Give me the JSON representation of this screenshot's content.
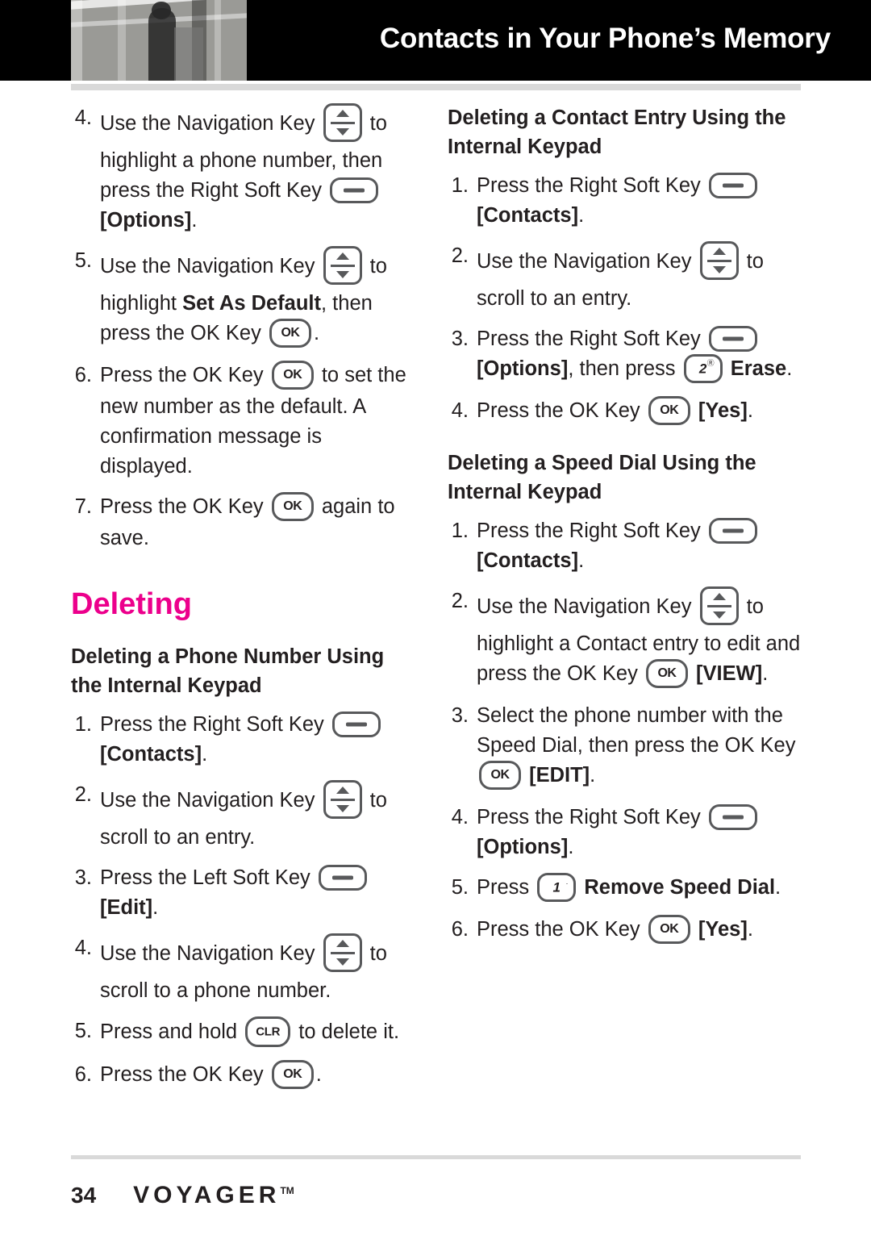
{
  "header": {
    "title": "Contacts in Your Phone’s Memory",
    "photo_alt": "header-photo"
  },
  "left_column": {
    "steps": [
      {
        "num": "4.",
        "parts": [
          {
            "t": "text",
            "v": "Use the Navigation Key "
          },
          {
            "t": "icon",
            "v": "navigation-key"
          },
          {
            "t": "text",
            "v": " to highlight a phone number, then press the Right Soft Key "
          },
          {
            "t": "icon",
            "v": "soft-key"
          },
          {
            "t": "text",
            "v": " "
          },
          {
            "t": "bold",
            "v": "[Options]"
          },
          {
            "t": "text",
            "v": "."
          }
        ]
      },
      {
        "num": "5.",
        "parts": [
          {
            "t": "text",
            "v": "Use the Navigation Key "
          },
          {
            "t": "icon",
            "v": "navigation-key"
          },
          {
            "t": "text",
            "v": " to highlight "
          },
          {
            "t": "bold",
            "v": "Set As Default"
          },
          {
            "t": "text",
            "v": ", then press the OK Key "
          },
          {
            "t": "icon",
            "v": "ok-key"
          },
          {
            "t": "text",
            "v": "."
          }
        ]
      },
      {
        "num": "6.",
        "parts": [
          {
            "t": "text",
            "v": "Press the OK Key "
          },
          {
            "t": "icon",
            "v": "ok-key"
          },
          {
            "t": "text",
            "v": " to set the new number as the default. A confirmation message is displayed."
          }
        ]
      },
      {
        "num": "7.",
        "parts": [
          {
            "t": "text",
            "v": "Press the OK Key "
          },
          {
            "t": "icon",
            "v": "ok-key"
          },
          {
            "t": "text",
            "v": " again to save."
          }
        ]
      }
    ],
    "section_title": "Deleting",
    "subhead": "Deleting a Phone Number Using the Internal Keypad",
    "steps2": [
      {
        "num": "1.",
        "parts": [
          {
            "t": "text",
            "v": "Press the Right Soft Key "
          },
          {
            "t": "icon",
            "v": "soft-key"
          },
          {
            "t": "text",
            "v": " "
          },
          {
            "t": "bold",
            "v": "[Contacts]"
          },
          {
            "t": "text",
            "v": "."
          }
        ]
      },
      {
        "num": "2.",
        "parts": [
          {
            "t": "text",
            "v": "Use the Navigation Key "
          },
          {
            "t": "icon",
            "v": "navigation-key"
          },
          {
            "t": "text",
            "v": " to scroll to an entry."
          }
        ]
      },
      {
        "num": "3.",
        "parts": [
          {
            "t": "text",
            "v": "Press the Left Soft Key "
          },
          {
            "t": "icon",
            "v": "soft-key"
          },
          {
            "t": "text",
            "v": " "
          },
          {
            "t": "bold",
            "v": "[Edit]"
          },
          {
            "t": "text",
            "v": "."
          }
        ]
      },
      {
        "num": "4.",
        "parts": [
          {
            "t": "text",
            "v": "Use the Navigation Key "
          },
          {
            "t": "icon",
            "v": "navigation-key"
          },
          {
            "t": "text",
            "v": " to scroll to a phone number."
          }
        ]
      },
      {
        "num": "5.",
        "parts": [
          {
            "t": "text",
            "v": "Press and hold "
          },
          {
            "t": "icon",
            "v": "clr-key"
          },
          {
            "t": "text",
            "v": " to delete it."
          }
        ]
      },
      {
        "num": "6.",
        "parts": [
          {
            "t": "text",
            "v": "Press the OK Key "
          },
          {
            "t": "icon",
            "v": "ok-key"
          },
          {
            "t": "text",
            "v": "."
          }
        ]
      }
    ]
  },
  "right_column": {
    "subhead1": "Deleting a Contact Entry Using the Internal Keypad",
    "steps1": [
      {
        "num": "1.",
        "parts": [
          {
            "t": "text",
            "v": "Press the Right Soft Key "
          },
          {
            "t": "icon",
            "v": "soft-key"
          },
          {
            "t": "text",
            "v": " "
          },
          {
            "t": "bold",
            "v": "[Contacts]"
          },
          {
            "t": "text",
            "v": "."
          }
        ]
      },
      {
        "num": "2.",
        "parts": [
          {
            "t": "text",
            "v": "Use the Navigation Key "
          },
          {
            "t": "icon",
            "v": "navigation-key"
          },
          {
            "t": "text",
            "v": " to scroll to an entry."
          }
        ]
      },
      {
        "num": "3.",
        "parts": [
          {
            "t": "text",
            "v": "Press the Right Soft Key "
          },
          {
            "t": "icon",
            "v": "soft-key"
          },
          {
            "t": "text",
            "v": " "
          },
          {
            "t": "bold",
            "v": "[Options]"
          },
          {
            "t": "text",
            "v": ", then press "
          },
          {
            "t": "icon",
            "v": "num-2-key"
          },
          {
            "t": "text",
            "v": " "
          },
          {
            "t": "bold",
            "v": "Erase"
          },
          {
            "t": "text",
            "v": "."
          }
        ]
      },
      {
        "num": "4.",
        "parts": [
          {
            "t": "text",
            "v": "Press the OK Key "
          },
          {
            "t": "icon",
            "v": "ok-key"
          },
          {
            "t": "text",
            "v": " "
          },
          {
            "t": "bold",
            "v": "[Yes]"
          },
          {
            "t": "text",
            "v": "."
          }
        ]
      }
    ],
    "subhead2": "Deleting a Speed Dial Using the Internal Keypad",
    "steps2": [
      {
        "num": "1.",
        "parts": [
          {
            "t": "text",
            "v": "Press the Right Soft Key "
          },
          {
            "t": "icon",
            "v": "soft-key"
          },
          {
            "t": "text",
            "v": " "
          },
          {
            "t": "bold",
            "v": "[Contacts]"
          },
          {
            "t": "text",
            "v": "."
          }
        ]
      },
      {
        "num": "2.",
        "parts": [
          {
            "t": "text",
            "v": "Use the Navigation Key "
          },
          {
            "t": "icon",
            "v": "navigation-key"
          },
          {
            "t": "text",
            "v": " to highlight a Contact entry to edit and press the OK Key "
          },
          {
            "t": "icon",
            "v": "ok-key"
          },
          {
            "t": "text",
            "v": " "
          },
          {
            "t": "bold",
            "v": "[VIEW]"
          },
          {
            "t": "text",
            "v": "."
          }
        ]
      },
      {
        "num": "3.",
        "parts": [
          {
            "t": "text",
            "v": "Select the phone number with the Speed Dial, then press the OK Key "
          },
          {
            "t": "icon",
            "v": "ok-key"
          },
          {
            "t": "text",
            "v": " "
          },
          {
            "t": "bold",
            "v": "[EDIT]"
          },
          {
            "t": "text",
            "v": "."
          }
        ]
      },
      {
        "num": "4.",
        "parts": [
          {
            "t": "text",
            "v": "Press the Right Soft Key "
          },
          {
            "t": "icon",
            "v": "soft-key"
          },
          {
            "t": "text",
            "v": " "
          },
          {
            "t": "bold",
            "v": "[Options]"
          },
          {
            "t": "text",
            "v": "."
          }
        ]
      },
      {
        "num": "5.",
        "parts": [
          {
            "t": "text",
            "v": "Press "
          },
          {
            "t": "icon",
            "v": "num-1-key"
          },
          {
            "t": "text",
            "v": " "
          },
          {
            "t": "bold",
            "v": "Remove Speed Dial"
          },
          {
            "t": "text",
            "v": "."
          }
        ]
      },
      {
        "num": "6.",
        "parts": [
          {
            "t": "text",
            "v": "Press the OK Key "
          },
          {
            "t": "icon",
            "v": "ok-key"
          },
          {
            "t": "text",
            "v": " "
          },
          {
            "t": "bold",
            "v": "[Yes]"
          },
          {
            "t": "text",
            "v": "."
          }
        ]
      }
    ]
  },
  "footer": {
    "page_number": "34",
    "brand": "VOYAGER",
    "trademark": "TM"
  },
  "colors": {
    "accent": "#ec008c",
    "header_bg": "#000000",
    "rule": "#d9d9d9",
    "text": "#231f20",
    "key_outline": "#58595b"
  },
  "icon_labels": {
    "ok": "OK",
    "clr": "CLR",
    "num1": "1",
    "num2": "2"
  }
}
